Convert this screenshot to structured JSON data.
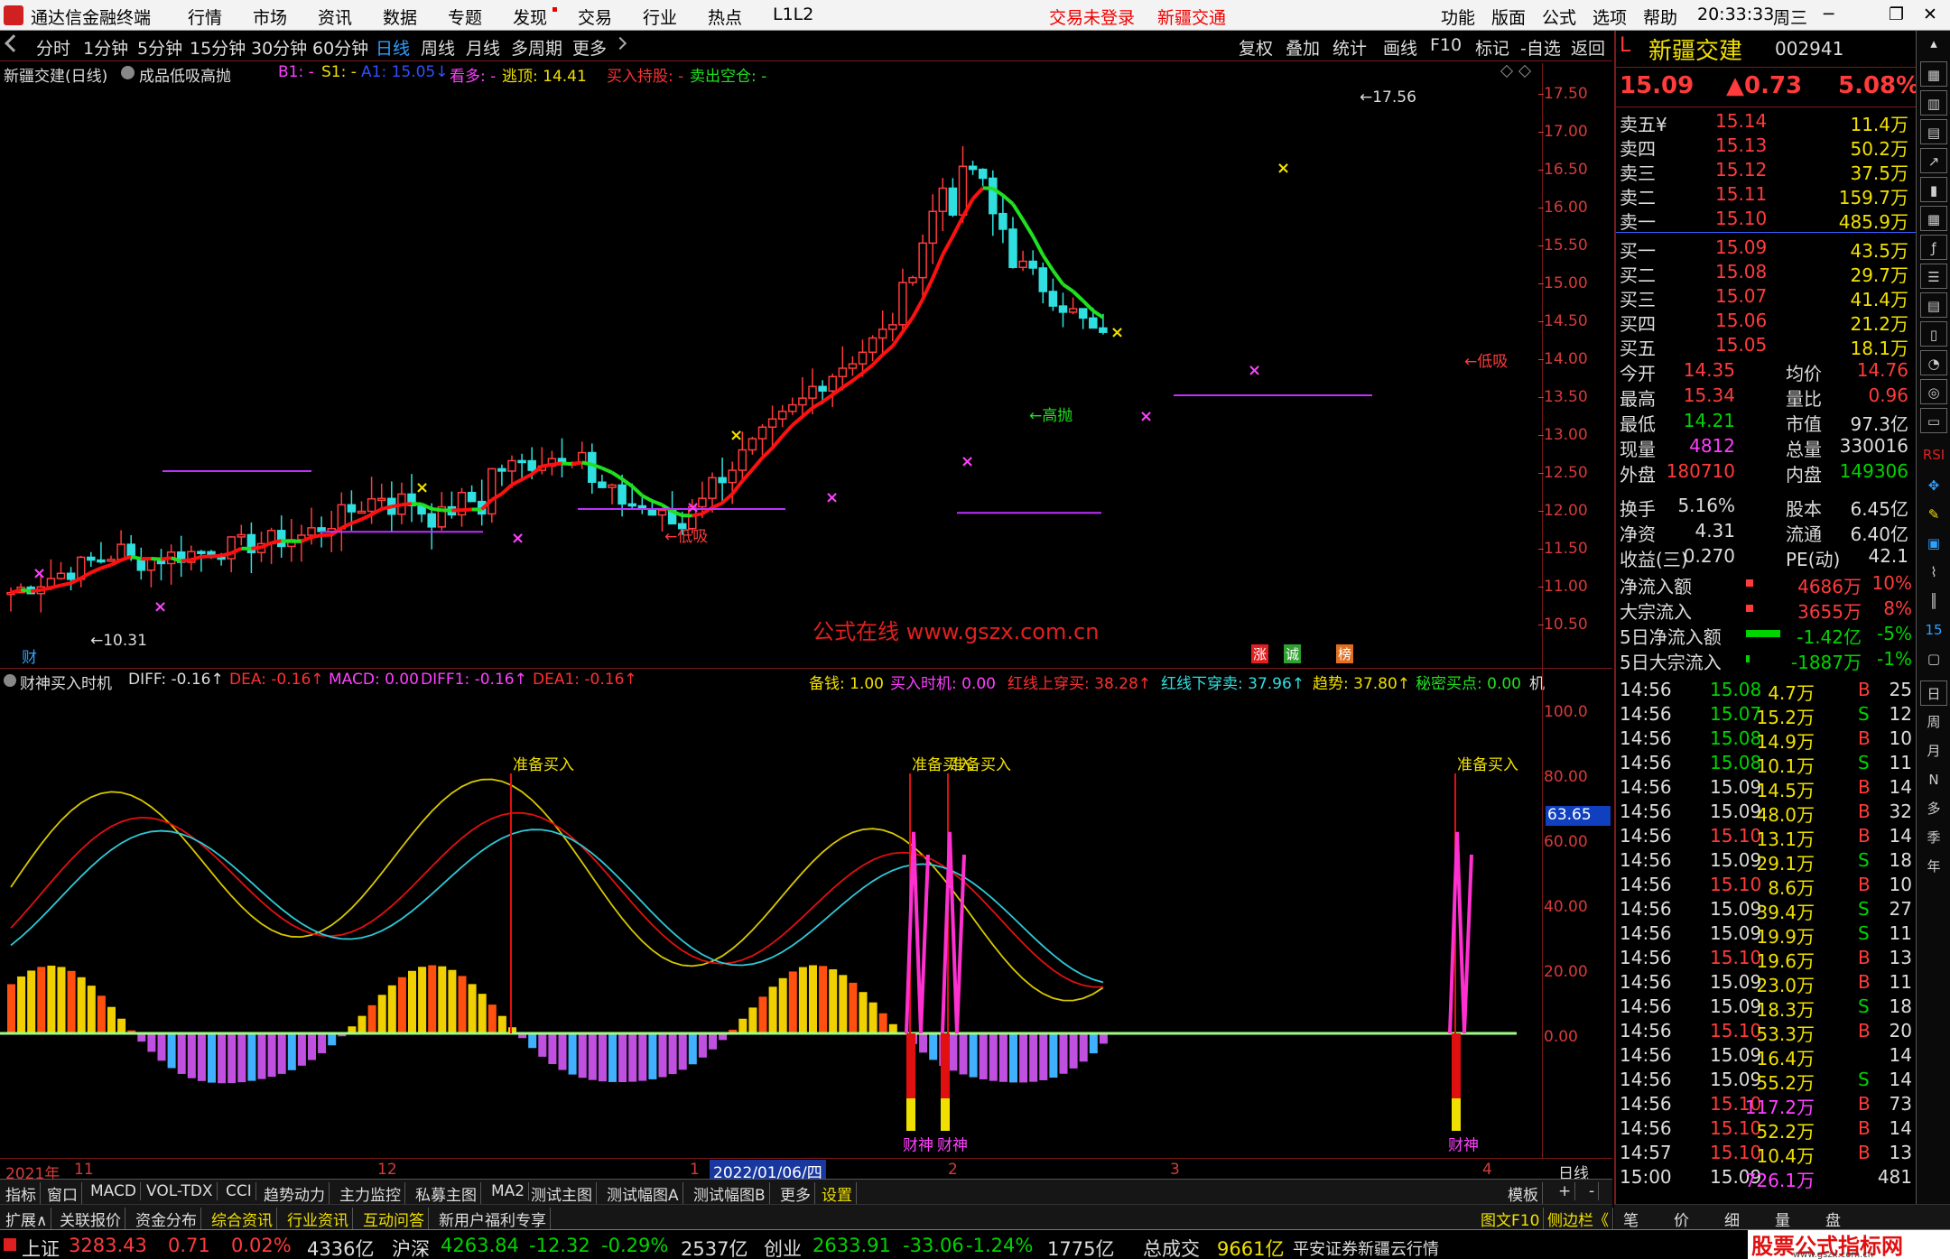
{
  "menubar": {
    "app_title": "通达信金融终端",
    "items": [
      "行情",
      "市场",
      "资讯",
      "数据",
      "专题",
      "发现",
      "交易",
      "行业",
      "热点",
      "L1L2"
    ],
    "status_login": "交易未登录",
    "stock_name": "新疆交通",
    "right_items": [
      "功能",
      "版面",
      "公式",
      "选项",
      "帮助"
    ],
    "time": "20:33:33",
    "weekday": "周三",
    "win_controls": [
      "─",
      "❐",
      "✕"
    ]
  },
  "toolbar": {
    "periods": [
      "分时",
      "1分钟",
      "5分钟",
      "15分钟",
      "30分钟",
      "60分钟",
      "日线",
      "周线",
      "月线",
      "多周期",
      "更多"
    ],
    "active": "日线",
    "tools": [
      "复权",
      "叠加",
      "统计",
      "画线",
      "F10",
      "标记",
      "-自选",
      "返回"
    ]
  },
  "main_chart": {
    "title": "新疆交建(日线)",
    "formula": "成品低吸高抛",
    "b1": "B1: -",
    "s1": "S1: -",
    "a1": "A1: 15.05↓",
    "kan_duo": "看多: -",
    "tao_ding": "逃顶: 14.41",
    "buy_hold": "买入持股: -",
    "sell_empty": "卖出空仓: -",
    "y_ticks": [
      "17.50",
      "17.00",
      "16.50",
      "16.00",
      "15.50",
      "15.00",
      "14.50",
      "14.00",
      "13.50",
      "13.00",
      "12.50",
      "12.00",
      "11.50",
      "11.00",
      "10.50"
    ],
    "high_label": "17.56",
    "low_label": "10.31",
    "signals": [
      "低吸",
      "高抛",
      "低吸"
    ],
    "watermark": "公式在线 www.gszx.com.cn",
    "cai_label": "财",
    "badges": [
      "涨",
      "诚",
      "榜"
    ]
  },
  "sub_chart": {
    "title": "财神买入时机",
    "diff": "DIFF: -0.16↑",
    "dea": "DEA: -0.16↑",
    "macd": "MACD: 0.00",
    "diff1": "DIFF1: -0.16↑",
    "dea1": "DEA1: -0.16↑",
    "beiqian": "备钱: 1.00",
    "buy_time": "买入时机: 0.00",
    "red_cross": "红线上穿买: 38.28↑",
    "blue_cross": "红线下穿卖: 37.96↑",
    "trend": "趋势: 37.80↑",
    "secret": "秘密买点: 0.00",
    "ji": "机",
    "y_ticks": [
      "100.0",
      "80.00",
      "60.00",
      "40.00",
      "20.00",
      "0.00"
    ],
    "current_value": "63.65",
    "prep_labels": [
      "准备买入",
      "准备买入",
      "准备买入",
      "准备买入"
    ],
    "caishen_labels": [
      "财神",
      "财神",
      "财神"
    ]
  },
  "date_axis": {
    "labels": [
      "2021年",
      "11",
      "12",
      "1",
      "2022/01/06/四",
      "2",
      "3",
      "4"
    ],
    "period": "日线"
  },
  "tabs": [
    "指标",
    "窗口",
    "MACD",
    "VOL-TDX",
    "CCI",
    "趋势动力",
    "主力监控",
    "私募主图",
    "MA2",
    "测试主图",
    "测试幅图A",
    "测试幅图B",
    "更多",
    "设置"
  ],
  "tabs_right": [
    "模板",
    "+",
    "-"
  ],
  "tabs2": [
    "扩展∧",
    "关联报价",
    "资金分布",
    "综合资讯",
    "行业资讯",
    "互动问答",
    "新用户福利专享"
  ],
  "tabs2_right": [
    "图文F10",
    "侧边栏《",
    "笔",
    "价",
    "细",
    "量",
    "盘"
  ],
  "quote": {
    "flag": "L",
    "name": "新疆交建",
    "code": "002941",
    "price": "15.09",
    "change": "▲0.73",
    "pct": "5.08%",
    "asks": [
      [
        "卖五¥",
        "15.14",
        "11.4万"
      ],
      [
        "卖四",
        "15.13",
        "50.2万"
      ],
      [
        "卖三",
        "15.12",
        "37.5万"
      ],
      [
        "卖二",
        "15.11",
        "159.7万"
      ],
      [
        "卖一",
        "15.10",
        "485.9万"
      ]
    ],
    "bids": [
      [
        "买一",
        "15.09",
        "43.5万"
      ],
      [
        "买二",
        "15.08",
        "29.7万"
      ],
      [
        "买三",
        "15.07",
        "41.4万"
      ],
      [
        "买四",
        "15.06",
        "21.2万"
      ],
      [
        "买五",
        "15.05",
        "18.1万"
      ]
    ],
    "stats": [
      [
        "今开",
        "14.35",
        "均价",
        "14.76"
      ],
      [
        "最高",
        "15.34",
        "量比",
        "0.96"
      ],
      [
        "最低",
        "14.21",
        "市值",
        "97.3亿"
      ],
      [
        "现量",
        "4812",
        "总量",
        "330016"
      ],
      [
        "外盘",
        "180710",
        "内盘",
        "149306"
      ]
    ],
    "stats2": [
      [
        "换手",
        "5.16%",
        "股本",
        "6.45亿"
      ],
      [
        "净资",
        "4.31",
        "流通",
        "6.40亿"
      ],
      [
        "收益(三)",
        "0.270",
        "PE(动)",
        "42.1"
      ]
    ],
    "flows": [
      [
        "净流入额",
        "4686万",
        "10%"
      ],
      [
        "大宗流入",
        "3655万",
        "8%"
      ],
      [
        "5日净流入额",
        "-1.42亿",
        "-5%"
      ],
      [
        "5日大宗流入",
        "-1887万",
        "-1%"
      ]
    ],
    "ticks": [
      [
        "14:56",
        "15.08",
        "4.7万",
        "B",
        "25"
      ],
      [
        "14:56",
        "15.07",
        "15.2万",
        "S",
        "12"
      ],
      [
        "14:56",
        "15.08",
        "14.9万",
        "B",
        "10"
      ],
      [
        "14:56",
        "15.08",
        "10.1万",
        "S",
        "11"
      ],
      [
        "14:56",
        "15.09",
        "14.5万",
        "B",
        "14"
      ],
      [
        "14:56",
        "15.09",
        "48.0万",
        "B",
        "32"
      ],
      [
        "14:56",
        "15.10",
        "13.1万",
        "B",
        "14"
      ],
      [
        "14:56",
        "15.09",
        "29.1万",
        "S",
        "18"
      ],
      [
        "14:56",
        "15.10",
        "8.6万",
        "B",
        "10"
      ],
      [
        "14:56",
        "15.09",
        "39.4万",
        "S",
        "27"
      ],
      [
        "14:56",
        "15.09",
        "19.9万",
        "S",
        "11"
      ],
      [
        "14:56",
        "15.10",
        "19.6万",
        "B",
        "13"
      ],
      [
        "14:56",
        "15.09",
        "23.0万",
        "B",
        "11"
      ],
      [
        "14:56",
        "15.09",
        "18.3万",
        "S",
        "18"
      ],
      [
        "14:56",
        "15.10",
        "53.3万",
        "B",
        "20"
      ],
      [
        "14:56",
        "15.09",
        "16.4万",
        "",
        "14"
      ],
      [
        "14:56",
        "15.09",
        "55.2万",
        "S",
        "14"
      ],
      [
        "14:56",
        "15.10",
        "117.2万",
        "B",
        "73"
      ],
      [
        "14:56",
        "15.10",
        "52.2万",
        "B",
        "14"
      ],
      [
        "14:57",
        "15.10",
        "10.4万",
        "B",
        "13"
      ],
      [
        "15:00",
        "15.09",
        "726.1万",
        "",
        "481"
      ]
    ]
  },
  "status": {
    "sh_name": "上证",
    "sh_val": "3283.43",
    "sh_chg": "0.71",
    "sh_pct": "0.02%",
    "sh_amt": "4336亿",
    "hs_name": "沪深",
    "hs_val": "4263.84",
    "hs_chg": "-12.32",
    "hs_pct": "-0.29%",
    "hs_amt": "2537亿",
    "cy_name": "创业",
    "cy_val": "2633.91",
    "cy_chg": "-33.06",
    "cy_pct": "-1.24%",
    "cy_amt": "1775亿",
    "total_label": "总成交",
    "total": "9661亿",
    "broker": "平安证券新疆云行情",
    "logo_text": "股票公式指标网",
    "logo_url": "www.gszx.com.cn"
  },
  "sidebar": [
    "日",
    "周",
    "月",
    "N",
    "多",
    "季",
    "年",
    "RSI",
    "15",
    "N"
  ],
  "colors": {
    "up": "#ff3b3b",
    "down": "#30e0e0",
    "ma_up": "#ff1010",
    "ma_down": "#20e020"
  }
}
